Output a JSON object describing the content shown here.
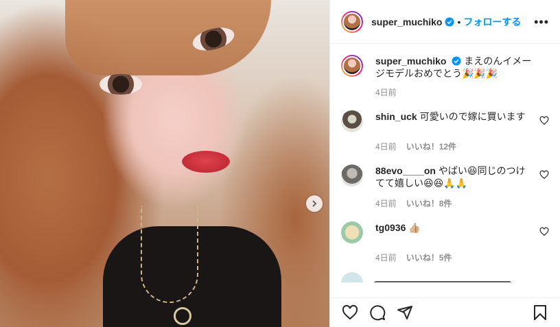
{
  "post": {
    "author": "super_muchiko",
    "follow_label": "フォローする",
    "separator": "•",
    "more_label": "•••"
  },
  "caption": {
    "author": "super_muchiko",
    "text": "まえのんイメージモデルおめでとう🎉🎉🎉",
    "time": "4日前"
  },
  "comments": [
    {
      "user": "shin_uck",
      "text": "可愛いので嫁に買います",
      "time": "4日前",
      "likes": "いいね！12件"
    },
    {
      "user": "88evo____on",
      "text": "やばい😆同じのつけてて嬉しい😆😆🙏🙏",
      "time": "4日前",
      "likes": "いいね！8件"
    },
    {
      "user": "tg0936",
      "text": "👍🏼",
      "time": "4日前",
      "likes": "いいね！5件"
    }
  ],
  "colors": {
    "link": "#0095f6",
    "muted": "#8e8e8e",
    "text": "#262626"
  },
  "icons": [
    "verified-badge-icon",
    "more-options-icon",
    "heart-icon",
    "like-icon",
    "comment-icon",
    "share-icon",
    "save-icon",
    "next-arrow-icon"
  ]
}
